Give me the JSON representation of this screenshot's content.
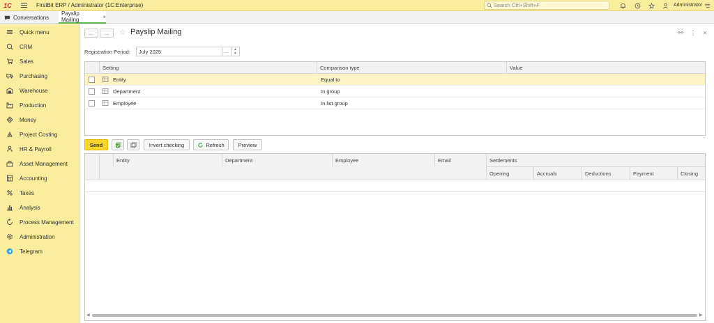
{
  "app": {
    "logo": "1C",
    "title": "FirstBit ERP / Administrator  (1C:Enterprise)",
    "search_placeholder": "Search Ctrl+Shift+F",
    "user": "Administrator"
  },
  "tabs": [
    {
      "label": "Conversations"
    },
    {
      "label": "Payslip Mailing",
      "close": "×"
    }
  ],
  "sidebar": {
    "items": [
      {
        "label": "Quick menu",
        "icon": "menu-icon"
      },
      {
        "label": "CRM",
        "icon": "crm-icon"
      },
      {
        "label": "Sales",
        "icon": "cart-icon"
      },
      {
        "label": "Purchasing",
        "icon": "truck-icon"
      },
      {
        "label": "Warehouse",
        "icon": "warehouse-icon"
      },
      {
        "label": "Production",
        "icon": "factory-icon"
      },
      {
        "label": "Money",
        "icon": "money-icon"
      },
      {
        "label": "Project Costing",
        "icon": "project-icon"
      },
      {
        "label": "HR & Payroll",
        "icon": "person-icon"
      },
      {
        "label": "Asset Management",
        "icon": "asset-icon"
      },
      {
        "label": "Accounting",
        "icon": "calculator-icon"
      },
      {
        "label": "Taxes",
        "icon": "percent-icon"
      },
      {
        "label": "Analysis",
        "icon": "chart-icon"
      },
      {
        "label": "Process Management",
        "icon": "process-icon"
      },
      {
        "label": "Administration",
        "icon": "gear-icon"
      },
      {
        "label": "Telegram",
        "icon": "telegram-icon"
      }
    ]
  },
  "form": {
    "title": "Payslip Mailing",
    "back": "←",
    "forward": "→",
    "star": "☆",
    "link_icon": "⚯",
    "more_icon": "⋮",
    "close_icon": "×",
    "reg_label": "Registration Period:",
    "reg_value": "July 2025",
    "reg_dots": "...",
    "settings": {
      "columns": [
        "Setting",
        "Comparison type",
        "Value"
      ],
      "rows": [
        {
          "setting": "Entity",
          "comparison": "Equal to",
          "value": ""
        },
        {
          "setting": "Department",
          "comparison": "In group",
          "value": ""
        },
        {
          "setting": "Employee",
          "comparison": "In list group",
          "value": ""
        }
      ]
    },
    "buttons": {
      "send": "Send",
      "invert": "Invert checking",
      "refresh": "Refresh",
      "preview": "Preview"
    },
    "results": {
      "columns": [
        "Entity",
        "Department",
        "Employee",
        "Email"
      ],
      "settlements": "Settlements",
      "settlement_columns": [
        "Opening",
        "Accruals",
        "Deductions",
        "Payment",
        "Closing"
      ]
    }
  }
}
